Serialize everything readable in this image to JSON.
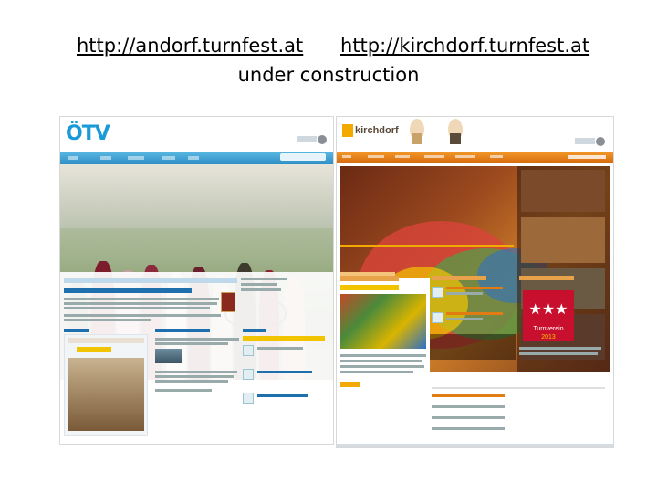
{
  "slide": {
    "link_andorf": "http://andorf.turnfest.at",
    "link_kirchdorf": "http://kirchdorf.turnfest.at",
    "subtitle": "under construction"
  },
  "colors": {
    "andorf_brand": "#1a9bd7",
    "kirchdorf_brand": "#e07c13"
  }
}
